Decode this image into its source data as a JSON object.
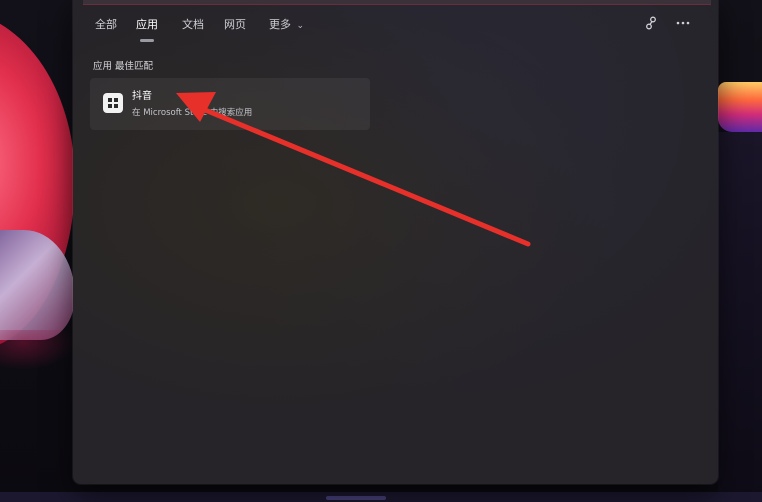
{
  "tabs": [
    {
      "label": "全部"
    },
    {
      "label": "应用"
    },
    {
      "label": "文档"
    },
    {
      "label": "网页"
    },
    {
      "label": "更多"
    }
  ],
  "active_tab": "应用",
  "toolbar_icons": [
    "share-icon",
    "more-icon"
  ],
  "best_match": {
    "heading": "应用 最佳匹配",
    "result": {
      "title": "抖音",
      "subtitle": "在 Microsoft Store 中搜索应用",
      "icon": "store-app-icon"
    }
  },
  "annotation": {
    "arrow_color": "#e8302b"
  },
  "colors": {
    "panel_bg": "#262429",
    "accent": "#e8302b"
  }
}
